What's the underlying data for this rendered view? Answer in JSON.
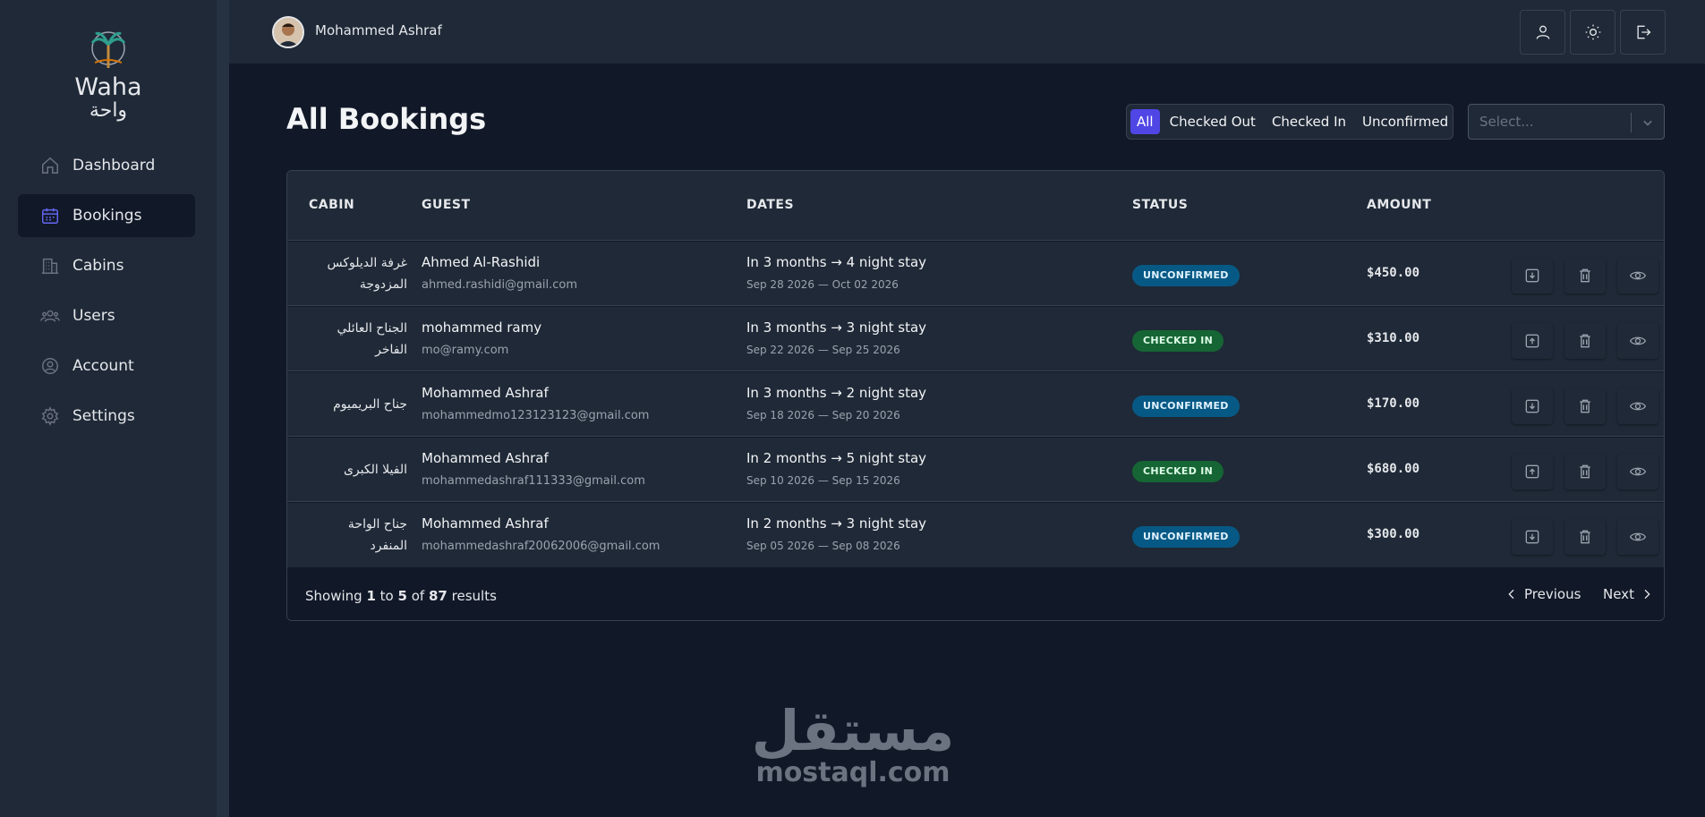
{
  "app": {
    "logo_en": "Waha",
    "logo_ar": "واحة"
  },
  "sidebar": {
    "items": [
      {
        "label": "Dashboard",
        "icon": "home-icon"
      },
      {
        "label": "Bookings",
        "icon": "calendar-icon",
        "active": true
      },
      {
        "label": "Cabins",
        "icon": "building-icon"
      },
      {
        "label": "Users",
        "icon": "users-icon"
      },
      {
        "label": "Account",
        "icon": "user-circle-icon"
      },
      {
        "label": "Settings",
        "icon": "gear-icon"
      }
    ]
  },
  "header": {
    "username": "Mohammed Ashraf",
    "buttons": [
      "user-icon",
      "sun-icon",
      "logout-icon"
    ]
  },
  "main": {
    "title": "All Bookings",
    "filters": [
      "All",
      "Checked Out",
      "Checked In",
      "Unconfirmed"
    ],
    "active_filter": "All",
    "sort_placeholder": "Select..."
  },
  "table": {
    "columns": [
      "CABIN",
      "GUEST",
      "DATES",
      "STATUS",
      "AMOUNT"
    ],
    "rows": [
      {
        "cabin": "غرفة الديلوكس المزدوجة",
        "guest": "Ahmed Al-Rashidi",
        "email": "ahmed.rashidi@gmail.com",
        "dates": "In 3 months → 4 night stay",
        "range": "Sep 28 2026 — Oct 02 2026",
        "status": "UNCONFIRMED",
        "amount": "$450.00"
      },
      {
        "cabin": "الجناح العائلي الفاخر",
        "guest": "mohammed ramy",
        "email": "mo@ramy.com",
        "dates": "In 3 months → 3 night stay",
        "range": "Sep 22 2026 — Sep 25 2026",
        "status": "CHECKED IN",
        "amount": "$310.00"
      },
      {
        "cabin": "جناح البريميوم",
        "guest": "Mohammed Ashraf",
        "email": "mohammedmo123123123@gmail.com",
        "dates": "In 3 months → 2 night stay",
        "range": "Sep 18 2026 — Sep 20 2026",
        "status": "UNCONFIRMED",
        "amount": "$170.00"
      },
      {
        "cabin": "الفيلا الكبرى",
        "guest": "Mohammed Ashraf",
        "email": "mohammedashraf111333@gmail.com",
        "dates": "In 2 months → 5 night stay",
        "range": "Sep 10 2026 — Sep 15 2026",
        "status": "CHECKED IN",
        "amount": "$680.00"
      },
      {
        "cabin": "جناح الواحة المنفرد",
        "guest": "Mohammed Ashraf",
        "email": "mohammedashraf20062006@gmail.com",
        "dates": "In 2 months → 3 night stay",
        "range": "Sep 05 2026 — Sep 08 2026",
        "status": "UNCONFIRMED",
        "amount": "$300.00"
      }
    ]
  },
  "pagination": {
    "prefix": "Showing",
    "from": "1",
    "to_word": "to",
    "to": "5",
    "of_word": "of",
    "total": "87",
    "suffix": "results",
    "previous": "Previous",
    "next": "Next"
  },
  "watermark": {
    "ar": "مستقل",
    "en": "mostaql.com"
  },
  "colors": {
    "accent": "#4f46e5",
    "unconfirmed": "#075985",
    "checked_in": "#166534"
  }
}
